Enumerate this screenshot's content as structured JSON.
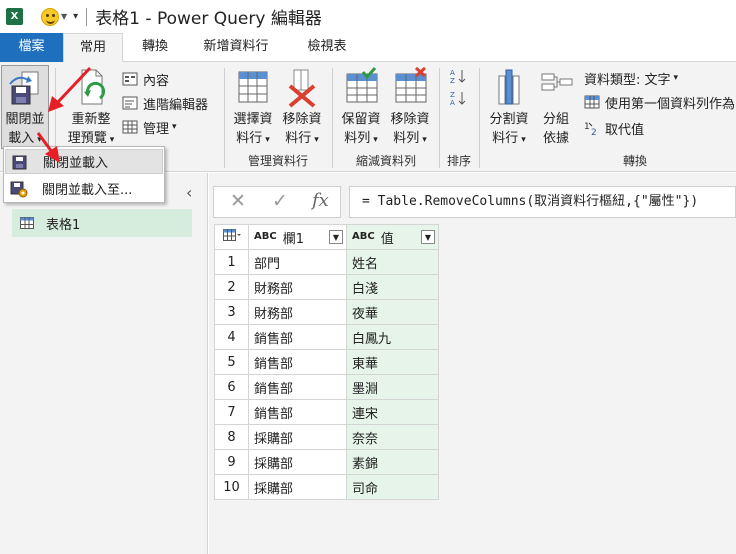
{
  "window": {
    "title": "表格1 - Power Query 編輯器"
  },
  "tabs": [
    {
      "label": "檔案"
    },
    {
      "label": "常用"
    },
    {
      "label": "轉換"
    },
    {
      "label": "新增資料行"
    },
    {
      "label": "檢視表"
    }
  ],
  "ribbon": {
    "close_load": {
      "line1": "關閉並",
      "line2": "載入"
    },
    "refresh": {
      "line1": "重新整",
      "line2": "理預覽"
    },
    "properties": "內容",
    "advanced_editor": "進階編輯器",
    "manage": "管理",
    "choose_columns": {
      "line1": "選擇資",
      "line2": "料行"
    },
    "remove_columns": {
      "line1": "移除資",
      "line2": "料行"
    },
    "group_manage_columns": "管理資料行",
    "keep_rows": {
      "line1": "保留資",
      "line2": "料列"
    },
    "remove_rows": {
      "line1": "移除資",
      "line2": "料列"
    },
    "group_reduce_rows": "縮減資料列",
    "group_sort": "排序",
    "split_column": {
      "line1": "分割資",
      "line2": "料行"
    },
    "group_by": {
      "line1": "分組",
      "line2": "依據"
    },
    "data_type": "資料類型: 文字",
    "first_row_header": "使用第一個資料列作為",
    "replace_values": "取代值",
    "group_transform": "轉換"
  },
  "dropdown": {
    "items": [
      {
        "label": "關閉並載入"
      },
      {
        "label": "關閉並載入至..."
      }
    ]
  },
  "queries": {
    "items": [
      {
        "label": "表格1"
      }
    ]
  },
  "formula": {
    "text": "= Table.RemoveColumns(取消資料行樞紐,{\"屬性\"})",
    "fx": "fx"
  },
  "grid": {
    "columns": [
      {
        "type_label": "ABC",
        "name": "欄1"
      },
      {
        "type_label": "ABC",
        "name": "值"
      }
    ],
    "rows": [
      {
        "n": "1",
        "c1": "部門",
        "c2": "姓名"
      },
      {
        "n": "2",
        "c1": "財務部",
        "c2": "白淺"
      },
      {
        "n": "3",
        "c1": "財務部",
        "c2": "夜華"
      },
      {
        "n": "4",
        "c1": "銷售部",
        "c2": "白鳳九"
      },
      {
        "n": "5",
        "c1": "銷售部",
        "c2": "東華"
      },
      {
        "n": "6",
        "c1": "銷售部",
        "c2": "墨淵"
      },
      {
        "n": "7",
        "c1": "銷售部",
        "c2": "連宋"
      },
      {
        "n": "8",
        "c1": "採購部",
        "c2": "奈奈"
      },
      {
        "n": "9",
        "c1": "採購部",
        "c2": "素錦"
      },
      {
        "n": "10",
        "c1": "採購部",
        "c2": "司命"
      }
    ]
  },
  "colors": {
    "file_tab": "#1f6fbf",
    "selected_query": "#d6ecdc",
    "selected_column": "#e6f4ea",
    "arrow": "#e81e25"
  }
}
